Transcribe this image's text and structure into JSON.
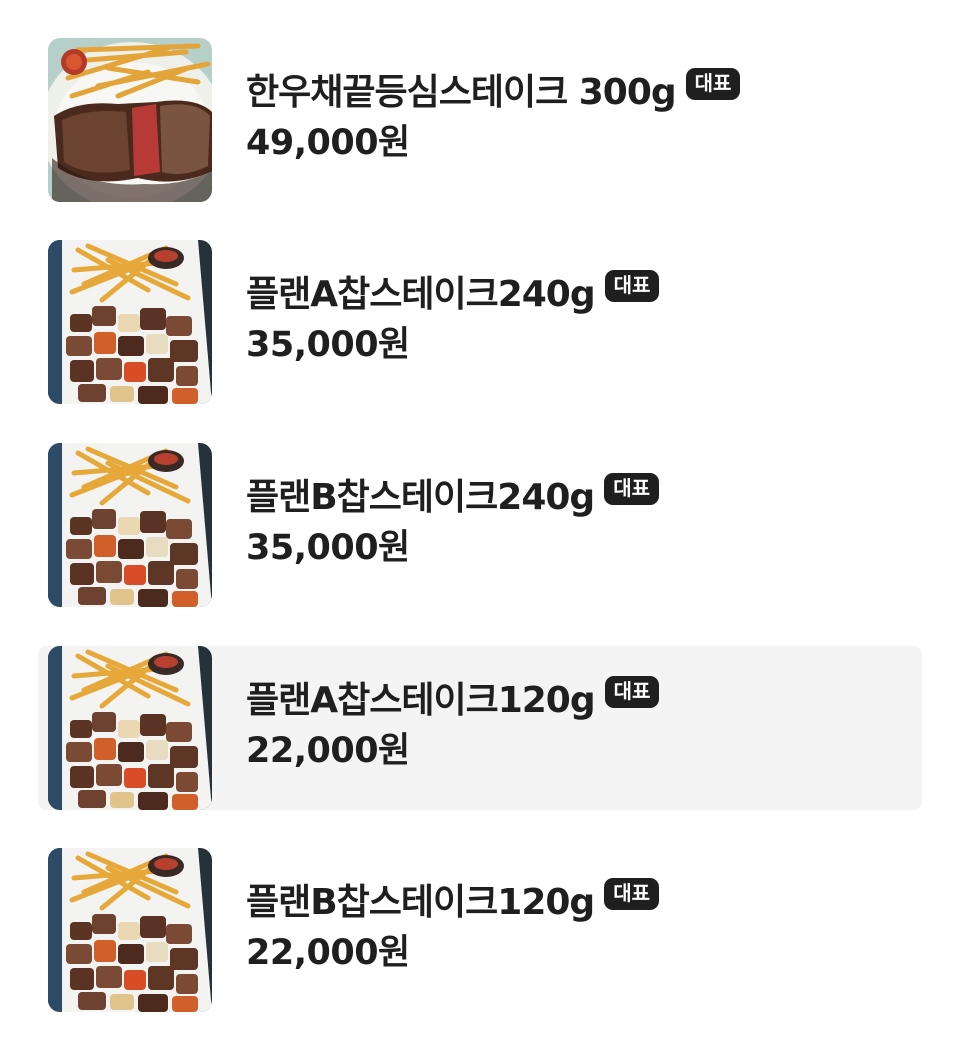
{
  "menu": {
    "items": [
      {
        "name": "한우채끝등심스테이크 300g",
        "badge": "대표",
        "price": "49,000원",
        "photo": "steak-with-fries-photo",
        "highlighted": false
      },
      {
        "name": "플랜A찹스테이크240g",
        "badge": "대표",
        "price": "35,000원",
        "photo": "chop-steak-photo",
        "highlighted": false
      },
      {
        "name": "플랜B찹스테이크240g",
        "badge": "대표",
        "price": "35,000원",
        "photo": "chop-steak-photo",
        "highlighted": false
      },
      {
        "name": "플랜A찹스테이크120g",
        "badge": "대표",
        "price": "22,000원",
        "photo": "chop-steak-photo",
        "highlighted": true
      },
      {
        "name": "플랜B찹스테이크120g",
        "badge": "대표",
        "price": "22,000원",
        "photo": "chop-steak-photo",
        "highlighted": false
      }
    ]
  },
  "colors": {
    "text": "#1f1f1f",
    "badge_bg": "#1f1f1f",
    "badge_text": "#ffffff",
    "highlight_bg": "#f4f4f4"
  }
}
